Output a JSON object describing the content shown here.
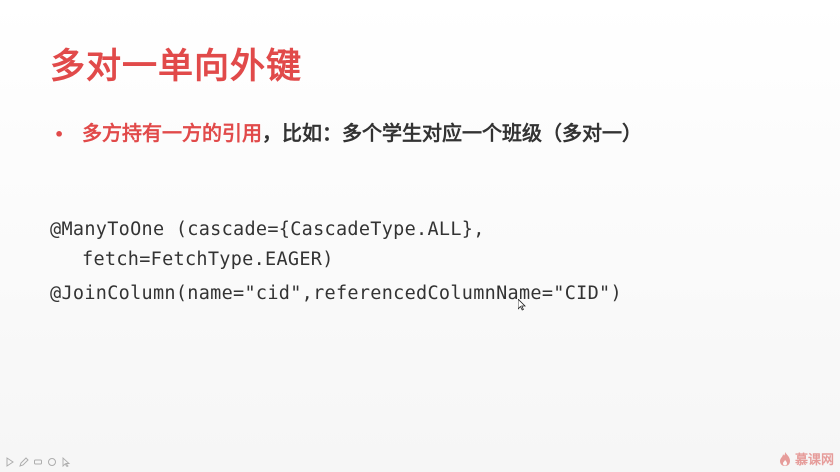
{
  "slide": {
    "title": "多对一单向外键",
    "bullet": {
      "highlight": "多方持有一方的引用",
      "rest": "，比如：多个学生对应一个班级（多对一）"
    },
    "code_lines": [
      "@ManyToOne (cascade={CascadeType.ALL},",
      "fetch=FetchType.EAGER)",
      "@JoinColumn(name=\"cid\",referencedColumnName=\"CID\")"
    ]
  },
  "watermark": {
    "text": "慕课网",
    "color": "#d9534f"
  },
  "colors": {
    "accent": "#e14a4a",
    "text": "#333333"
  },
  "toolbar": {
    "icons": [
      "play-icon",
      "pen-icon",
      "eraser-icon",
      "annotate-icon",
      "pointer-icon"
    ]
  }
}
